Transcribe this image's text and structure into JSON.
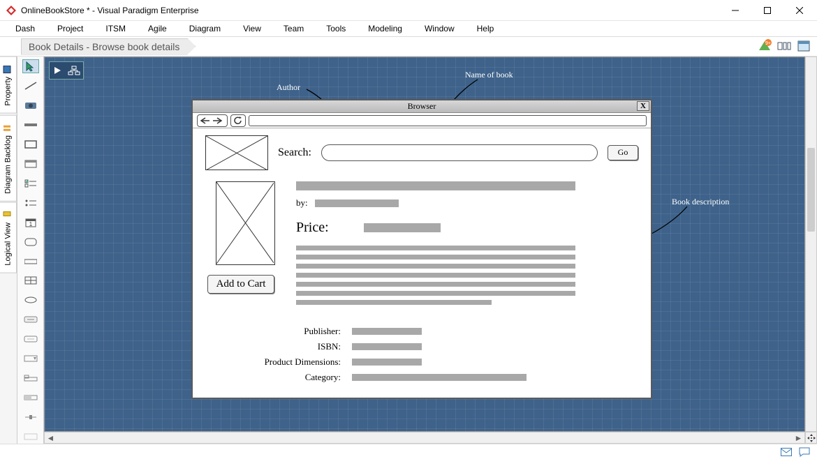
{
  "window": {
    "title": "OnlineBookStore * - Visual Paradigm Enterprise"
  },
  "menu": {
    "items": [
      "Dash",
      "Project",
      "ITSM",
      "Agile",
      "Diagram",
      "View",
      "Team",
      "Tools",
      "Modeling",
      "Window",
      "Help"
    ]
  },
  "breadcrumb": "Book Details - Browse book details",
  "sidetabs": {
    "property": "Property",
    "diagram_backlog": "Diagram Backlog",
    "logical_view": "Logical View"
  },
  "wireframe": {
    "browser_title": "Browser",
    "close": "X",
    "search_label": "Search:",
    "go_label": "Go",
    "by_label": "by:",
    "price_label": "Price:",
    "add_to_cart": "Add to Cart",
    "meta": {
      "publisher": "Publisher:",
      "isbn": "ISBN:",
      "dimensions": "Product Dimensions:",
      "category": "Category:"
    }
  },
  "annotations": {
    "author": "Author",
    "name_of_book": "Name of book",
    "description": "Book description"
  },
  "colors": {
    "canvas_bg": "#3e628a",
    "wf_grey": "#a8a8a8"
  }
}
